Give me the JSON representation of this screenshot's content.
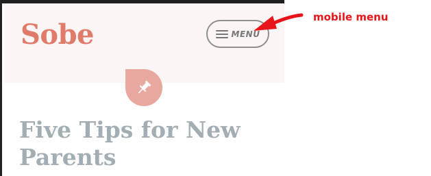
{
  "site": {
    "title": "Sobe",
    "menu_label": "MENU",
    "accent_color": "#e07b6b",
    "badge_color": "#e9a89f",
    "badge_icon": "pushpin-icon"
  },
  "post": {
    "title": "Five Tips for New Parents"
  },
  "annotation": {
    "label": "mobile menu",
    "color": "#e8151b"
  }
}
